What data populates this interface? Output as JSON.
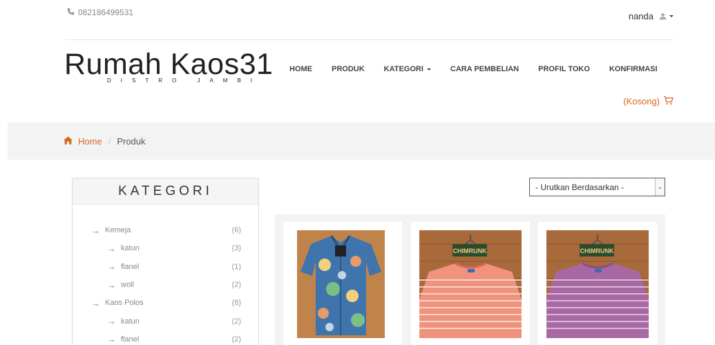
{
  "header": {
    "phone": "082186499531",
    "username": "nanda",
    "logo_title": "Rumah Kaos31",
    "logo_subtitle": "DISTRO JAMBI"
  },
  "nav": {
    "items": [
      {
        "label": "HOME"
      },
      {
        "label": "PRODUK"
      },
      {
        "label": "KATEGORI"
      },
      {
        "label": "CARA PEMBELIAN"
      },
      {
        "label": "PROFIL TOKO"
      },
      {
        "label": "KONFIRMASI"
      }
    ]
  },
  "cart": {
    "label": "(Kosong)"
  },
  "breadcrumb": {
    "home": "Home",
    "current": "Produk"
  },
  "sidebar": {
    "title": "KATEGORI",
    "items": [
      {
        "label": "Kemeja",
        "count": "(6)"
      },
      {
        "label": "katun",
        "count": "(3)"
      },
      {
        "label": "flanel",
        "count": "(1)"
      },
      {
        "label": "woll",
        "count": "(2)"
      },
      {
        "label": "Kaos Polos",
        "count": "(8)"
      },
      {
        "label": "katun",
        "count": "(2)"
      },
      {
        "label": "flanel",
        "count": "(2)"
      }
    ]
  },
  "sort": {
    "selected": "- Urutkan Berdasarkan -"
  },
  "products": [
    {
      "image": "floral-shirt"
    },
    {
      "image": "red-striped-tshirt",
      "tag": "CHIMRUNK"
    },
    {
      "image": "purple-striped-tshirt",
      "tag": "CHIMRUNK"
    }
  ],
  "colors": {
    "accent": "#d9661f"
  }
}
